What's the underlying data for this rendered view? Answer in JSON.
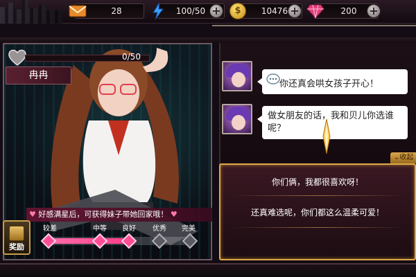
{
  "resources": {
    "mail_count": "28",
    "stamina": "100/50",
    "gold": "10476",
    "gems": "200",
    "plus_symbol": "+",
    "coin_symbol": "$"
  },
  "character": {
    "name": "冉冉",
    "affection_text": "0/50",
    "affection_fraction": 0.0,
    "hint": "好感满星后，可获得妹子带她回家哦！",
    "reward_label": "奖励",
    "levels": [
      "较差",
      "中等",
      "良好",
      "优秀",
      "完美"
    ],
    "current_level_index": 2
  },
  "chat": {
    "messages": [
      {
        "text": "你还真会哄女孩子开心！"
      },
      {
        "text": "做女朋友的话，我和贝儿你选谁呢？"
      }
    ],
    "collapse_label": "收起",
    "options": [
      "你们俩，我都很喜欢呀！",
      "还真难选呢，你们都这么温柔可爱！"
    ]
  },
  "colors": {
    "accent_gold": "#e1a94a",
    "affection_pink": "#ff3d8a"
  }
}
